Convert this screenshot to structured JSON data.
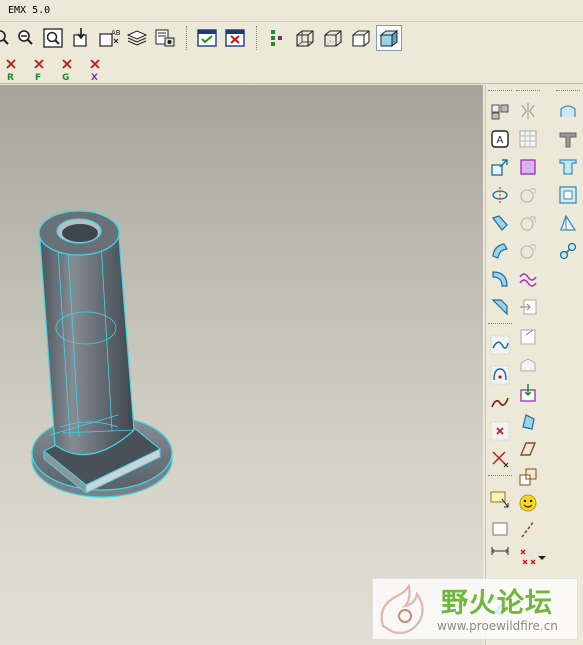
{
  "window": {
    "title": "EMX 5.0"
  },
  "toolbar_main": {
    "icons": [
      "zoom-in-icon",
      "zoom-out-icon",
      "refit-icon",
      "repaint-icon",
      "orient-icon",
      "layers-icon",
      "saved-view-icon",
      "model-tree-check-icon",
      "close-window-icon",
      "datum-display-icon",
      "wireframe-icon",
      "hidden-line-icon",
      "no-hidden-icon",
      "shading-icon"
    ],
    "active": "shading-icon"
  },
  "toolbar_toggles": [
    {
      "icon": "regen-toggle-icon",
      "letter": "R"
    },
    {
      "icon": "feature-toggle-icon",
      "letter": "F"
    },
    {
      "icon": "group-toggle-icon",
      "letter": "G"
    },
    {
      "icon": "x-toggle-icon",
      "letter": "X"
    }
  ],
  "feature_toolbar": {
    "icons": [
      "pattern-icon",
      "mirror-icon",
      "round-surface-icon",
      "info-icon",
      "grid-icon",
      "t-slot-icon",
      "transform-icon",
      "purple-square-icon",
      "u-channel-icon",
      "revolve-icon",
      "circle-gray-icon",
      "box-cut-icon",
      "sweep-icon",
      "circle-gray2-icon",
      "draft-icon",
      "blend-icon",
      "circle-gray3-icon",
      "chain-icon",
      "round-icon",
      "wave-icon",
      "chamfer-icon",
      "insert-icon",
      "sketch-curve-icon",
      "corner-icon",
      "datum-curve-icon",
      "edit-gray-icon",
      "spline-icon",
      "move-down-icon",
      "datum-point-icon",
      "solid-icon",
      "axis-cross-icon",
      "parallelogram-icon",
      "csys-icon",
      "stack-icon",
      "note-icon",
      "smiley-icon",
      "rectangle-icon",
      "dash-line-icon",
      "dimension-icon",
      "points-icon",
      "dropdown-arrow-icon",
      "cosmetic-icon"
    ]
  },
  "watermark": {
    "chinese": "野火论坛",
    "url": "www.proewildfire.cn"
  },
  "colors": {
    "accent": "#3fd6e4",
    "body": "#6e747c",
    "background_top": "#a5a49c",
    "background_bottom": "#e1dfd2",
    "watermark_green": "#70b83c"
  }
}
